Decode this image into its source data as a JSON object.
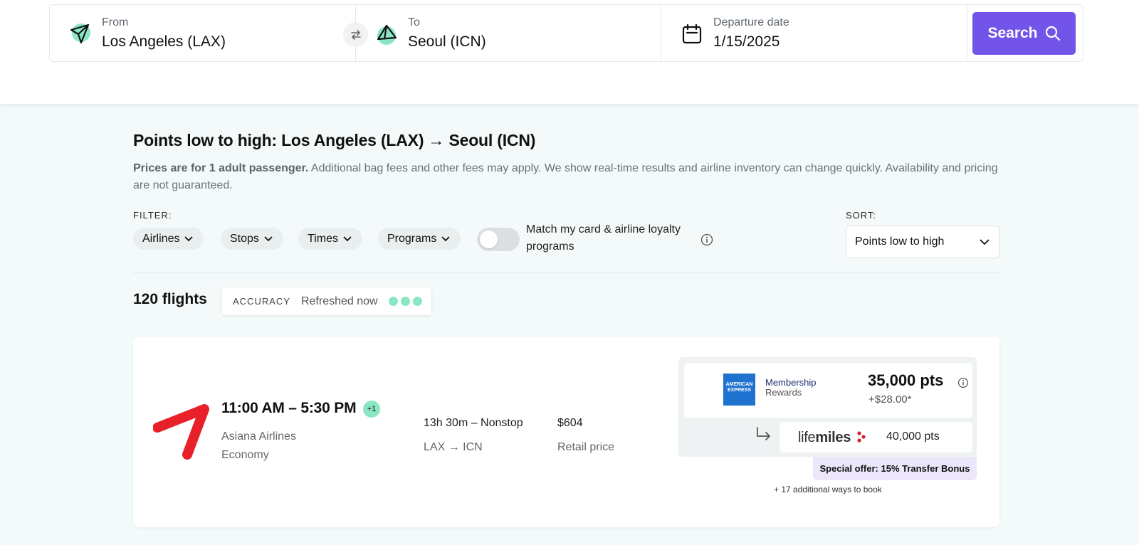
{
  "search": {
    "from_label": "From",
    "from_value": "Los Angeles (LAX)",
    "to_label": "To",
    "to_value": "Seoul (ICN)",
    "date_label": "Departure date",
    "date_value": "1/15/2025",
    "search_button": "Search"
  },
  "results": {
    "title": "Points low to high: Los Angeles (LAX) → Seoul (ICN)",
    "notice_bold": "Prices are for 1 adult passenger.",
    "notice_text": " Additional bag fees and other fees may apply. We show real-time results and airline inventory can change quickly. Availability and pricing are not guaranteed."
  },
  "filters": {
    "label": "FILTER:",
    "chips": [
      "Airlines",
      "Stops",
      "Times",
      "Programs"
    ],
    "toggle_label": "Match my card & airline loyalty programs"
  },
  "sort": {
    "label": "SORT:",
    "selected": "Points low to high"
  },
  "summary": {
    "count": "120 flights",
    "accuracy_label": "ACCURACY",
    "accuracy_status": "Refreshed now"
  },
  "flight": {
    "time": "11:00 AM – 5:30 PM",
    "day_offset": "+1",
    "airline": "Asiana Airlines",
    "cabin": "Economy",
    "duration": "13h 30m – Nonstop",
    "route": "LAX → ICN",
    "price": "$604",
    "price_label": "Retail price",
    "offer": {
      "card_logo_text": "AMERICAN EXPRESS",
      "program_line1": "Membership",
      "program_line2": "Rewards",
      "points": "35,000 pts",
      "fees": "+$28.00*",
      "partner_pre": "life",
      "partner_bold": "miles",
      "partner_points": "40,000 pts",
      "special": "Special offer: 15% Transfer Bonus",
      "more": "+ 17 additional ways to book"
    }
  },
  "colors": {
    "accent": "#7254e8",
    "mint": "#8be6c4",
    "airline_red": "#e8202a",
    "amex_blue": "#1f72cf",
    "special_bg": "#ece6fb"
  }
}
